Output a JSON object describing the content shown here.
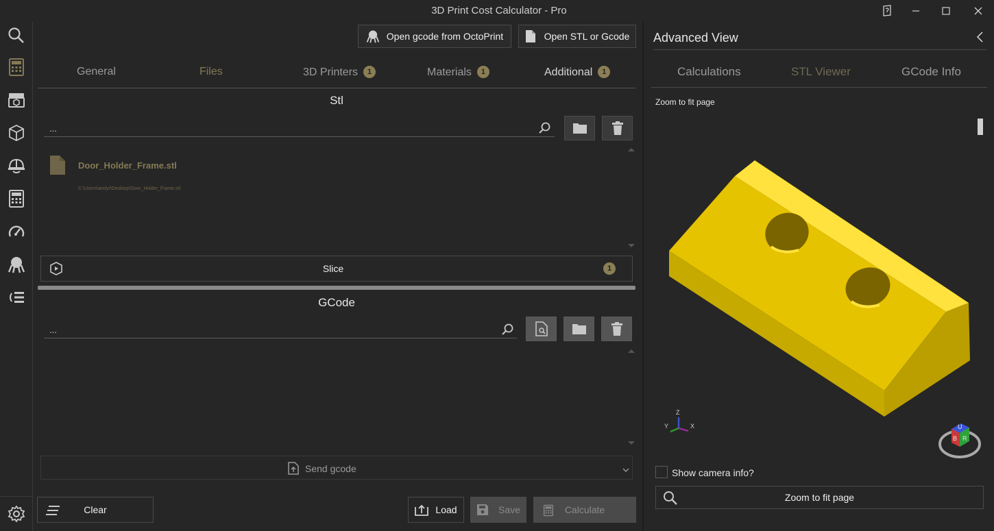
{
  "window": {
    "title": "3D Print Cost Calculator - Pro"
  },
  "sidebar": {
    "icons": [
      "search-icon",
      "calculator-icon",
      "printer-icon",
      "cube-icon",
      "helmet-icon",
      "calculator-grid-icon",
      "gauge-icon",
      "octopus-icon",
      "list-icon"
    ],
    "settings_icon": "gear-icon"
  },
  "toolbar": {
    "octoprint_label": "Open gcode from OctoPrint",
    "stl_gcode_label": "Open STL or Gcode"
  },
  "tabs": [
    {
      "label": "General",
      "badge": ""
    },
    {
      "label": "Files",
      "badge": ""
    },
    {
      "label": "3D Printers",
      "badge": "1"
    },
    {
      "label": "Materials",
      "badge": "1"
    },
    {
      "label": "Additional",
      "badge": "1"
    }
  ],
  "stl": {
    "title": "Stl",
    "input_value": "...",
    "file": {
      "name": "Door_Holder_Frame.stl",
      "path": "C:\\Users\\andyr\\Desktop\\Door_Holder_Frame.stl"
    },
    "slice_label": "Slice",
    "slice_badge": "1"
  },
  "gcode": {
    "title": "GCode",
    "input_value": "...",
    "send_label": "Send gcode"
  },
  "bottom": {
    "clear_label": "Clear",
    "load_label": "Load",
    "save_label": "Save",
    "calculate_label": "Calculate"
  },
  "advanced": {
    "title": "Advanced View",
    "tabs": [
      "Calculations",
      "STL Viewer",
      "GCode Info"
    ],
    "zoom_hint": "Zoom to fit page",
    "axes": {
      "z": "Z",
      "y": "Y",
      "x": "X"
    },
    "cube_faces": {
      "top": "U",
      "left": "B",
      "right": "R"
    },
    "camera_info_label": "Show camera info?",
    "zoom_button_label": "Zoom to fit page"
  },
  "colors": {
    "accent": "#857a55",
    "model": "#e6c300",
    "background": "#262626"
  }
}
